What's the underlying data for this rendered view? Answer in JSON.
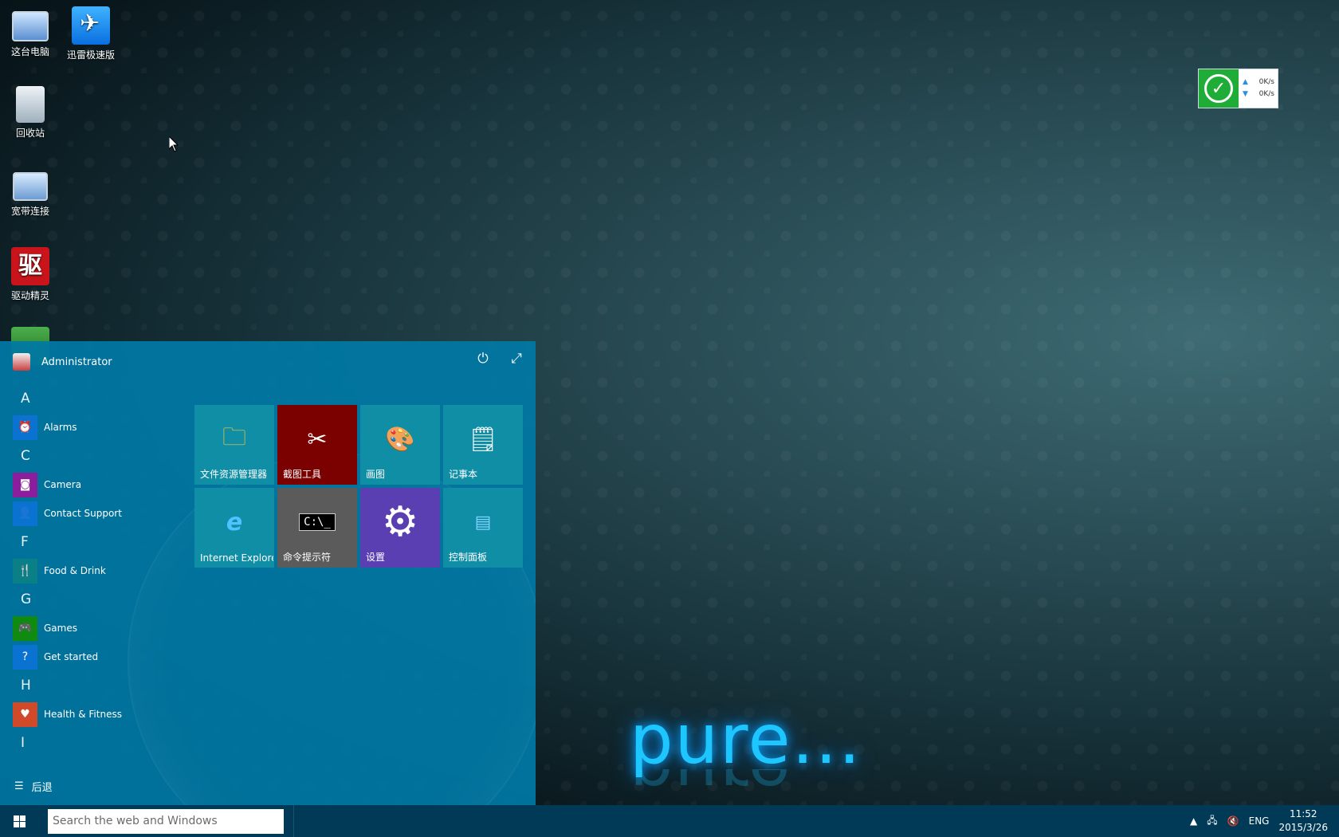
{
  "desktop": {
    "icons": [
      {
        "label": "这台电脑"
      },
      {
        "label": "迅雷极速版"
      },
      {
        "label": "回收站"
      },
      {
        "label": "宽带连接"
      },
      {
        "label": "驱动精灵"
      }
    ],
    "logo_text": "pure..."
  },
  "net_widget": {
    "up_rate": "0K/s",
    "down_rate": "0K/s",
    "status_color": "#1fad37"
  },
  "start_menu": {
    "user_name": "Administrator",
    "letters": [
      "A",
      "C",
      "F",
      "G",
      "H",
      "I"
    ],
    "apps": {
      "alarms": "Alarms",
      "camera": "Camera",
      "contact_support": "Contact Support",
      "food_drink": "Food & Drink",
      "games": "Games",
      "get_started": "Get started",
      "health_fitness": "Health & Fitness"
    },
    "back_label": "后退",
    "tiles": [
      {
        "label": "文件资源管理器",
        "icon": "folder-icon"
      },
      {
        "label": "截图工具",
        "icon": "scissors-icon"
      },
      {
        "label": "画图",
        "icon": "paint-palette-icon"
      },
      {
        "label": "记事本",
        "icon": "notepad-icon"
      },
      {
        "label": "Internet Explorer",
        "icon": "internet-explorer-icon"
      },
      {
        "label": "命令提示符",
        "icon": "command-prompt-icon"
      },
      {
        "label": "设置",
        "icon": "gear-icon"
      },
      {
        "label": "控制面板",
        "icon": "control-panel-icon"
      }
    ]
  },
  "taskbar": {
    "search_placeholder": "Search the web and Windows",
    "language": "ENG",
    "time": "11:52",
    "date": "2015/3/26"
  }
}
